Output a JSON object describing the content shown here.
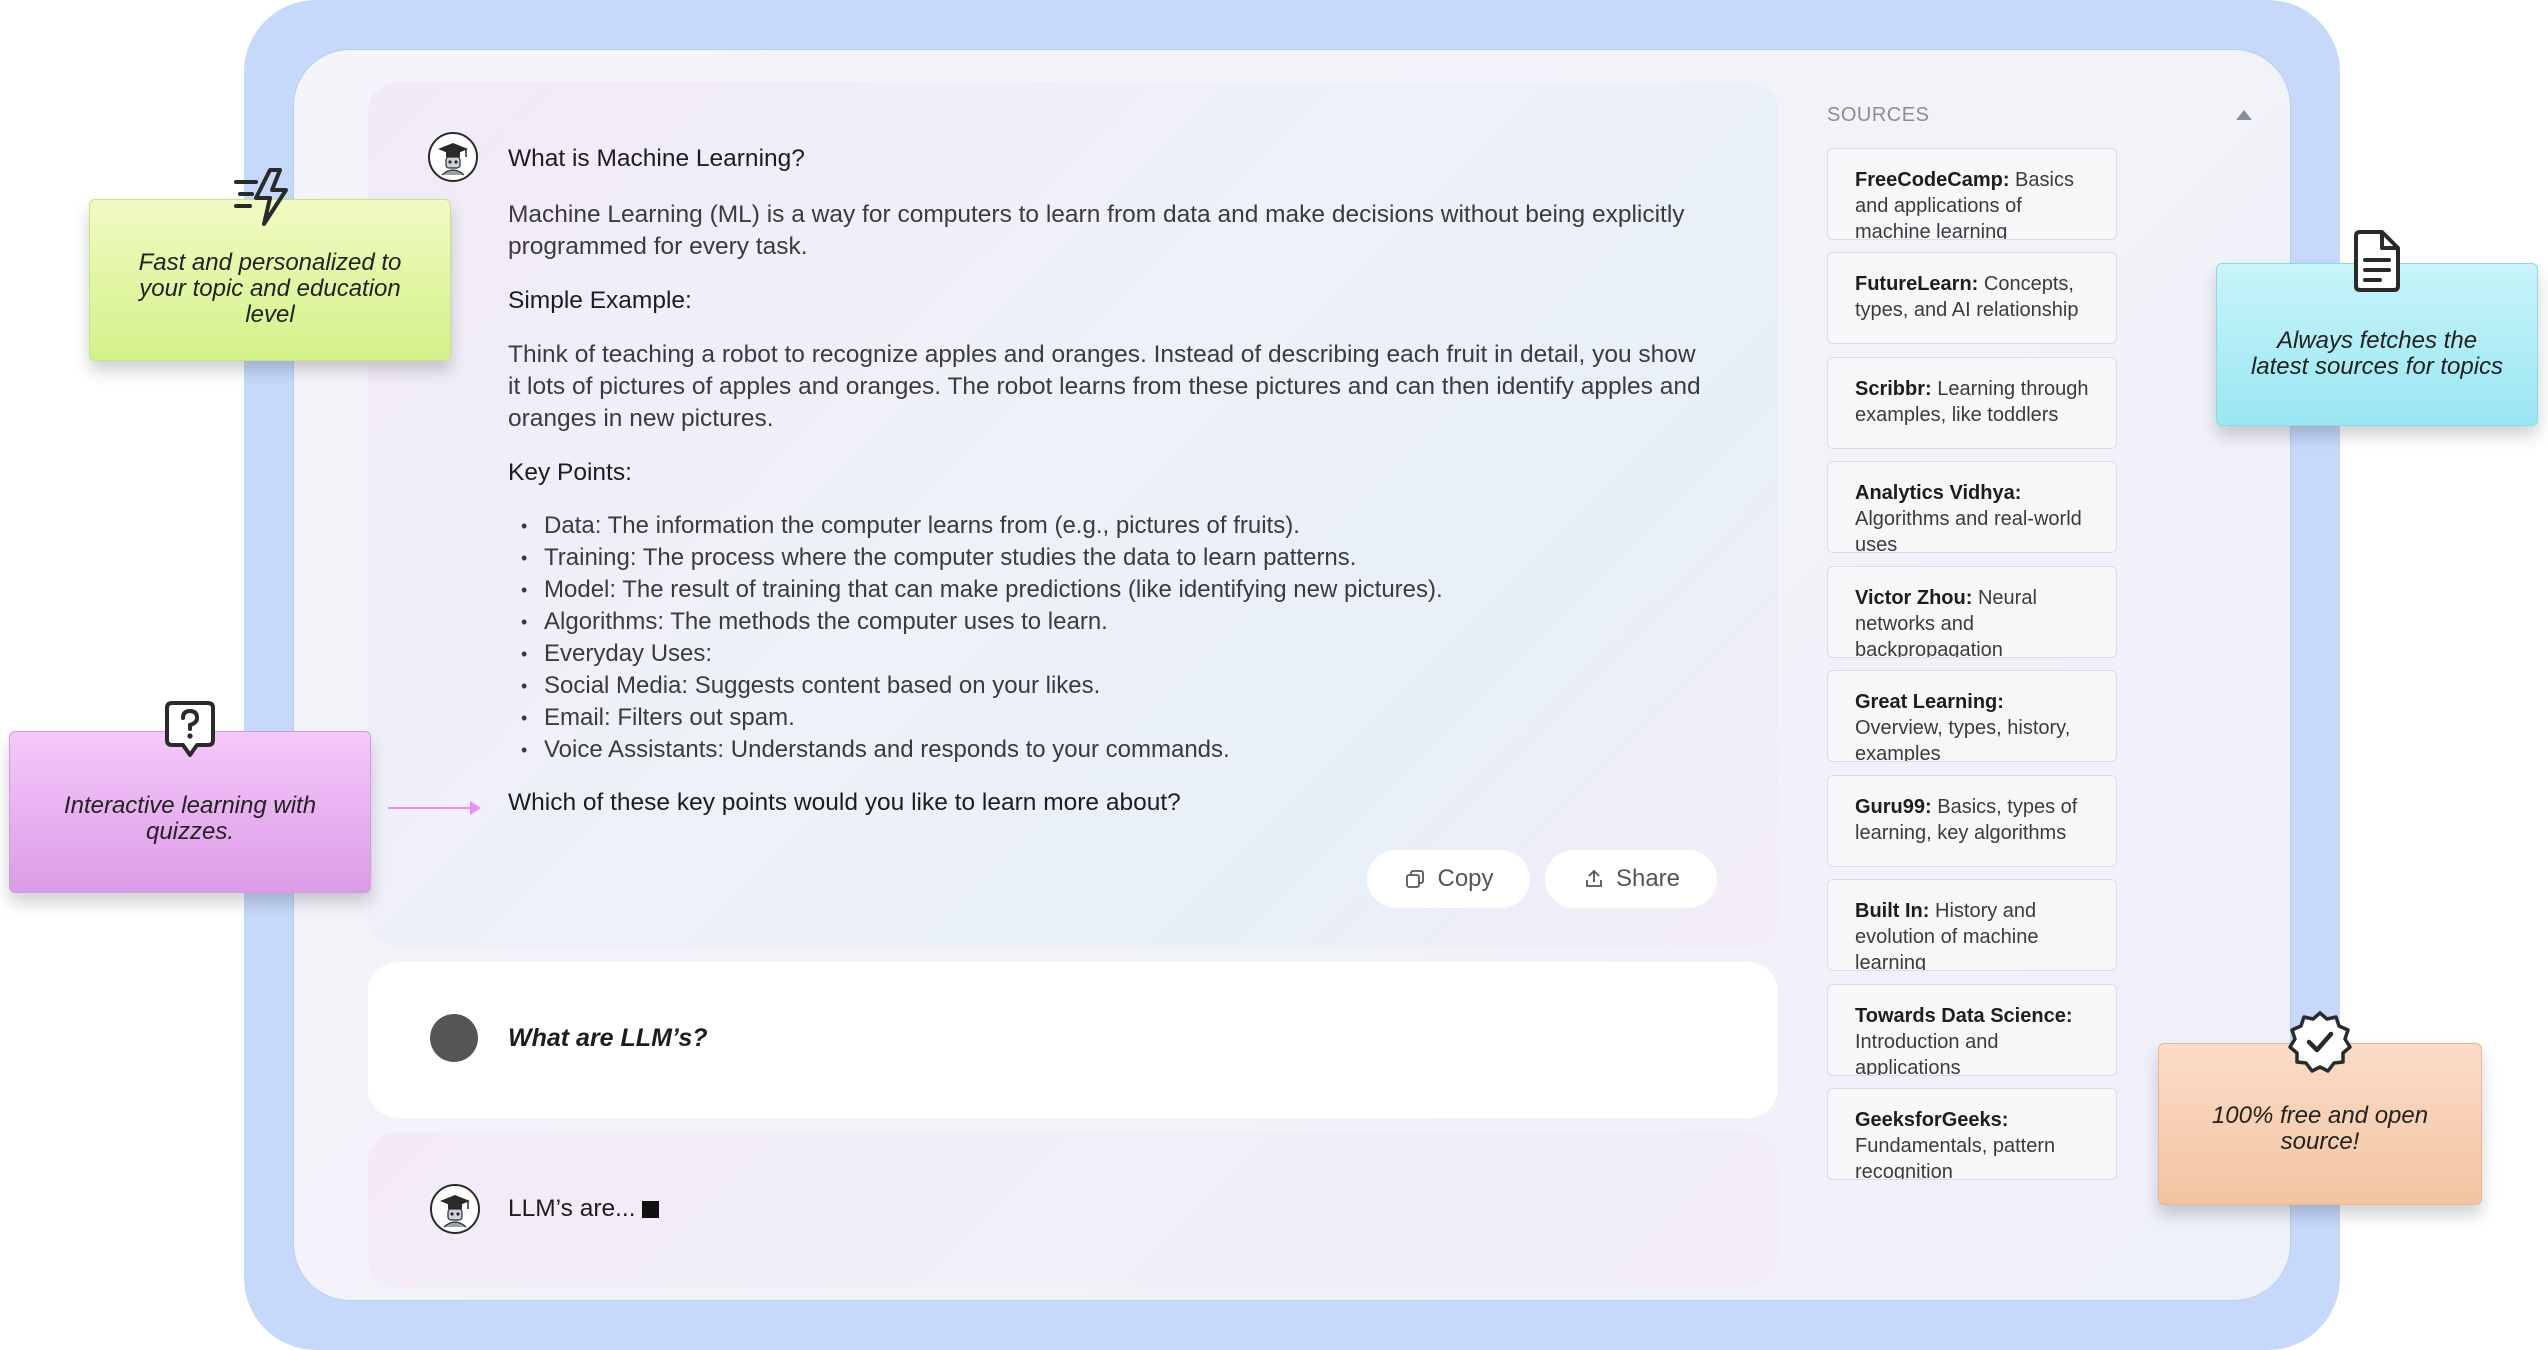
{
  "chat": {
    "question": "What is Machine Learning?",
    "intro": "Machine Learning (ML) is a way for computers to learn from data and make decisions without being explicitly programmed for every task.",
    "example_heading": "Simple Example:",
    "example_text": "Think of teaching a robot to recognize apples and oranges. Instead of describing each fruit in detail, you show it lots of pictures of apples and oranges. The robot learns from these pictures and can then identify apples and oranges in new pictures.",
    "key_heading": "Key Points:",
    "points": [
      "Data: The information the computer learns from (e.g., pictures of fruits).",
      "Training: The process where the computer studies the data to learn patterns.",
      "Model: The result of training that can make predictions (like identifying new pictures).",
      "Algorithms: The methods the computer uses to learn.",
      "Everyday Uses:",
      "Social Media: Suggests content based on your likes.",
      "Email: Filters out spam.",
      "Voice Assistants: Understands and responds to your commands."
    ],
    "followup": "Which of these key points would you like to learn more about?",
    "copy_label": "Copy",
    "share_label": "Share",
    "user_question": "What are LLM’s?",
    "typing_text": "LLM’s are..."
  },
  "sources": {
    "title": "SOURCES",
    "items": [
      {
        "name": "FreeCodeCamp:",
        "desc": "Basics and applications of machine learning"
      },
      {
        "name": "FutureLearn:",
        "desc": "Concepts, types, and AI relationship"
      },
      {
        "name": "Scribbr:",
        "desc": "Learning through examples, like toddlers"
      },
      {
        "name": "Analytics Vidhya:",
        "desc": "Algorithms and real-world uses"
      },
      {
        "name": "Victor Zhou:",
        "desc": "Neural networks and backpropagation"
      },
      {
        "name": "Great Learning:",
        "desc": "Overview, types, history, examples"
      },
      {
        "name": "Guru99:",
        "desc": "Basics, types of learning, key algorithms"
      },
      {
        "name": "Built In:",
        "desc": "History and evolution of machine learning"
      },
      {
        "name": "Towards Data Science:",
        "desc": "Introduction and applications"
      },
      {
        "name": "GeeksforGeeks:",
        "desc": "Fundamentals, pattern recognition"
      }
    ]
  },
  "callouts": {
    "fast": "Fast and personalized to your topic and education level",
    "sources": "Always fetches the latest sources for topics",
    "quiz": "Interactive learning with quizzes.",
    "free": "100% free and open source!"
  },
  "icons": {
    "fast": "lightning-icon",
    "sources": "document-icon",
    "quiz": "question-bubble-icon",
    "free": "verified-badge-icon",
    "copy": "copy-icon",
    "share": "share-icon",
    "collapse": "caret-up-icon"
  }
}
